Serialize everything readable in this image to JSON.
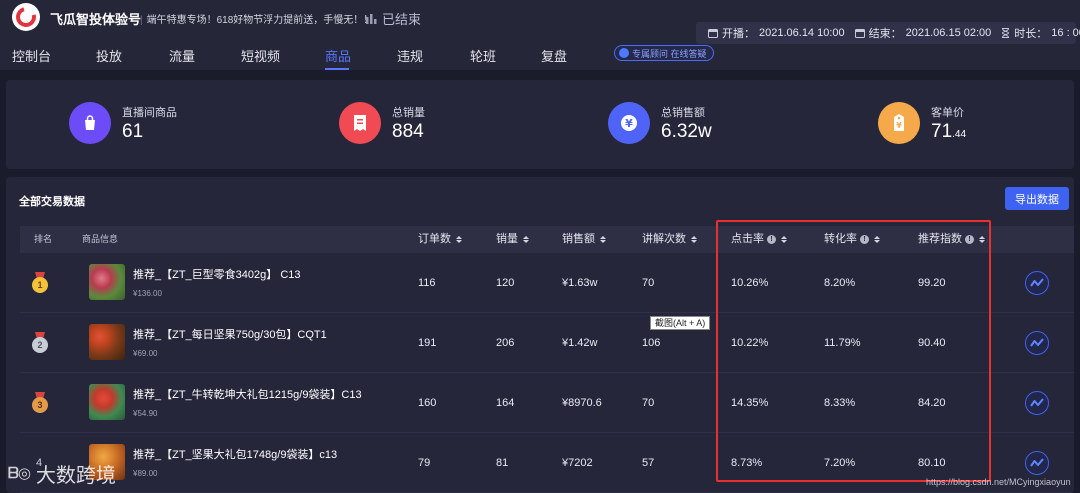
{
  "header": {
    "brand": "飞瓜智投体验号",
    "notice": "端午特惠专场！618好物节浮力提前送，手慢无！！",
    "status": "已结束",
    "start_label": "开播：",
    "start_value": "2021.06.14 10:00",
    "end_label": "结束：",
    "end_value": "2021.06.15 02:00",
    "duration_label": "时长：",
    "duration_value": "16 : 00",
    "tabs": [
      "控制台",
      "投放",
      "流量",
      "短视频",
      "商品",
      "违规",
      "轮班",
      "复盘"
    ],
    "active_tab": "商品",
    "consult": "专属顾问 在线答疑"
  },
  "stats": [
    {
      "label": "直播间商品",
      "value": "61",
      "color": "#6c4cf6",
      "icon": "shopping-bag-icon"
    },
    {
      "label": "总销量",
      "value": "884",
      "color": "#f04a55",
      "icon": "receipt-icon"
    },
    {
      "label": "总销售额",
      "value": "6.32w",
      "color": "#4f64f6",
      "icon": "yen-icon"
    },
    {
      "label": "客单价",
      "value": "71",
      "value_decimal": ".44",
      "color": "#f5a94a",
      "icon": "price-tag-icon"
    }
  ],
  "table": {
    "title": "全部交易数据",
    "export_label": "导出数据",
    "headers": {
      "rank": "排名",
      "product": "商品信息",
      "orders": "订单数",
      "sales": "销量",
      "revenue": "销售额",
      "explain": "讲解次数",
      "ctr": "点击率",
      "conversion": "转化率",
      "index": "推荐指数"
    },
    "rows": [
      {
        "rank": "1",
        "name": "推荐_【ZT_巨型零食3402g】 C13",
        "price": "¥136.00",
        "orders": "116",
        "sales": "120",
        "revenue": "¥1.63w",
        "explain": "70",
        "ctr": "10.26%",
        "conversion": "8.20%",
        "index": "99.20"
      },
      {
        "rank": "2",
        "name": "推荐_【ZT_每日坚果750g/30包】CQT1",
        "price": "¥69.00",
        "orders": "191",
        "sales": "206",
        "revenue": "¥1.42w",
        "explain": "106",
        "ctr": "10.22%",
        "conversion": "11.79%",
        "index": "90.40"
      },
      {
        "rank": "3",
        "name": "推荐_【ZT_牛转乾坤大礼包1215g/9袋装】C13",
        "price": "¥54.90",
        "orders": "160",
        "sales": "164",
        "revenue": "¥8970.6",
        "explain": "70",
        "ctr": "14.35%",
        "conversion": "8.33%",
        "index": "84.20"
      },
      {
        "rank": "4",
        "name": "推荐_【ZT_坚果大礼包1748g/9袋装】c13",
        "price": "¥89.00",
        "orders": "79",
        "sales": "81",
        "revenue": "¥7202",
        "explain": "57",
        "ctr": "8.73%",
        "conversion": "7.20%",
        "index": "80.10"
      }
    ]
  },
  "tooltip": "截图(Alt + A)",
  "watermark_left": "大数跨境",
  "watermark_right": "https://blog.csdn.net/MCyingxiaoyun",
  "colors": {
    "accent": "#5876ff",
    "highlight": "#e8312f",
    "background": "#1b1c2b"
  }
}
